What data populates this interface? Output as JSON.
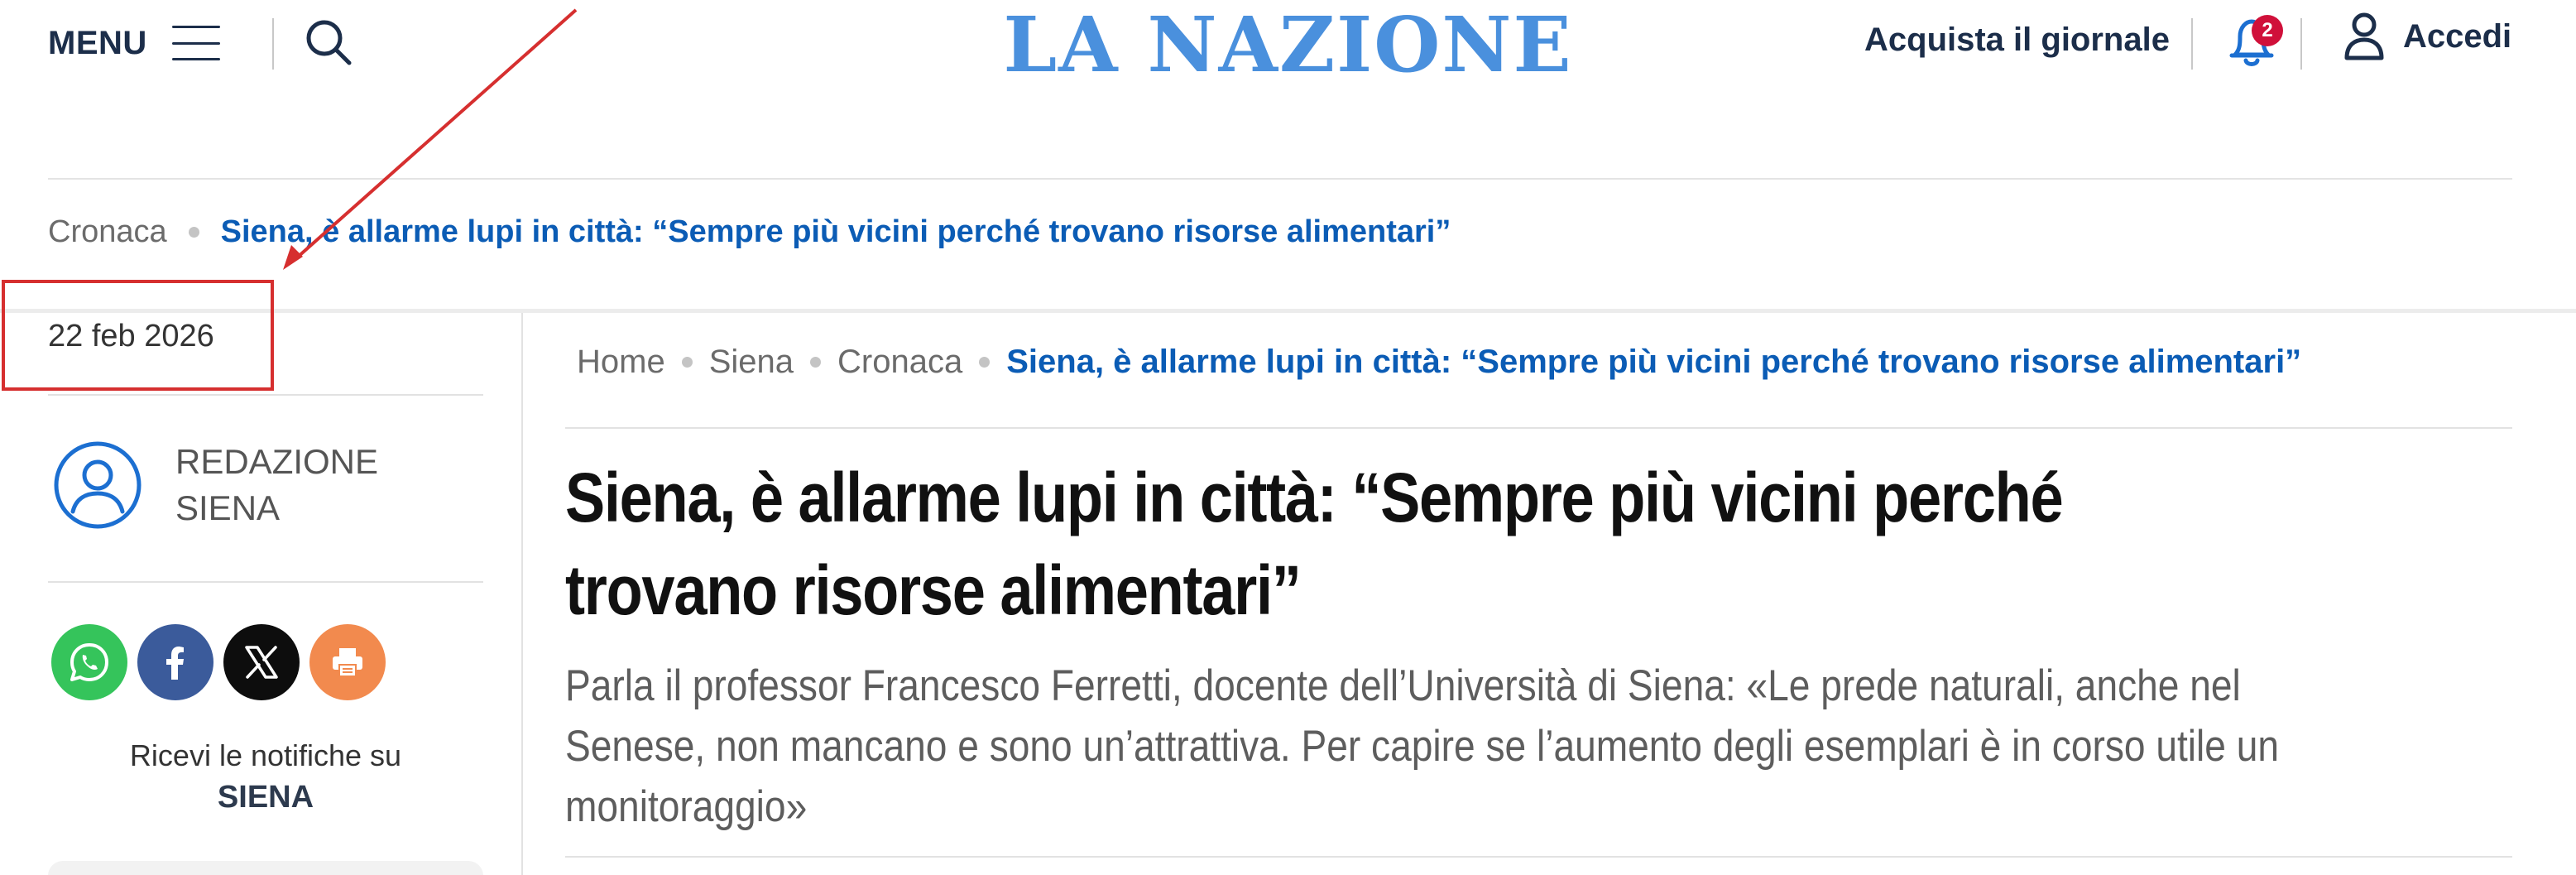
{
  "header": {
    "menu_label": "MENU",
    "logo_text": "LA NAZIONE",
    "buy_label": "Acquista il giornale",
    "notification_count": "2",
    "login_label": "Accedi",
    "logo_color": "#4a90dd",
    "navy_color": "#1c2e4a",
    "badge_color": "#d0103a"
  },
  "top_breadcrumb": {
    "section": "Cronaca",
    "current": "Siena, è allarme lupi in città: “Sempre più vicini perché trovano risorse alimentari”"
  },
  "sidebar": {
    "date": "22 feb 2026",
    "author": "REDAZIONE SIENA",
    "share_buttons": [
      "whatsapp-icon",
      "facebook-icon",
      "x-icon",
      "print-icon"
    ],
    "notify_text": "Ricevi le notifiche su",
    "notify_city": "SIENA"
  },
  "article": {
    "breadcrumb": [
      "Home",
      "Siena",
      "Cronaca"
    ],
    "breadcrumb_current": "Siena, è allarme lupi in città: “Sempre più vicini perché trovano risorse alimentari”",
    "title": "Siena, è allarme lupi in città: “Sempre più vicini perché trovano risorse alimentari”",
    "subtitle": "Parla il professor Francesco Ferretti, docente dell’Università di Siena: «Le prede naturali, anche nel Senese, non mancano e sono un’attrattiva. Per capire se l’aumento degli esemplari è in corso utile un monitoraggio»",
    "link_color": "#0b5cb5"
  },
  "annotation": {
    "color": "#d62f2f"
  }
}
